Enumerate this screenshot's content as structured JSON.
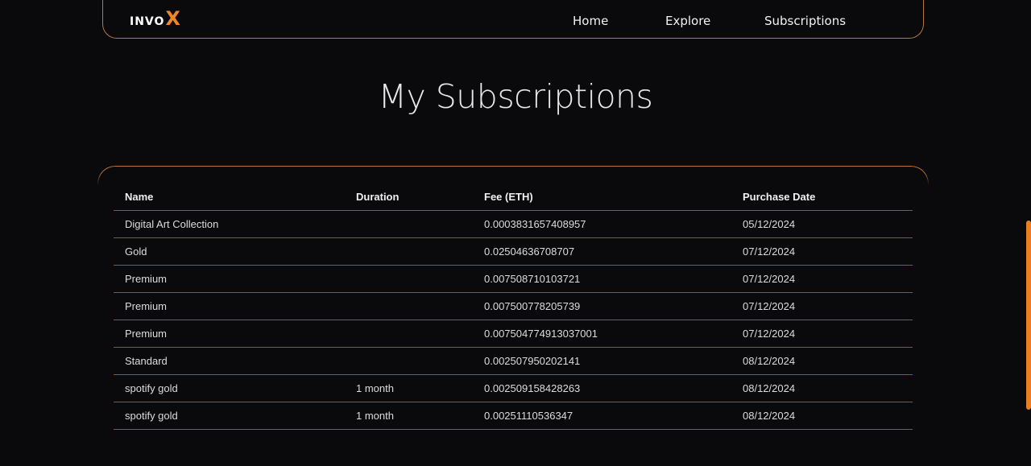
{
  "nav": {
    "logo_text": "INVO",
    "logo_accent": "X",
    "links": [
      "Home",
      "Explore",
      "Subscriptions"
    ]
  },
  "page": {
    "title": "My Subscriptions"
  },
  "table": {
    "headers": [
      "Name",
      "Duration",
      "Fee (ETH)",
      "Purchase Date"
    ],
    "rows": [
      {
        "name": "Digital Art Collection",
        "duration": "",
        "fee": "0.0003831657408957",
        "date": "05/12/2024"
      },
      {
        "name": "Gold",
        "duration": "",
        "fee": "0.02504636708707",
        "date": "07/12/2024"
      },
      {
        "name": "Premium",
        "duration": "",
        "fee": "0.007508710103721",
        "date": "07/12/2024"
      },
      {
        "name": "Premium",
        "duration": "",
        "fee": "0.007500778205739",
        "date": "07/12/2024"
      },
      {
        "name": "Premium",
        "duration": "",
        "fee": "0.007504774913037001",
        "date": "07/12/2024"
      },
      {
        "name": "Standard",
        "duration": "",
        "fee": "0.002507950202141",
        "date": "08/12/2024"
      },
      {
        "name": "spotify gold",
        "duration": "1 month",
        "fee": "0.002509158428263",
        "date": "08/12/2024"
      },
      {
        "name": "spotify gold",
        "duration": "1 month",
        "fee": "0.00251110536347",
        "date": "08/12/2024"
      }
    ]
  },
  "colors": {
    "accent": "#f0862a",
    "border": "#b8783a",
    "background": "#0a0a0c"
  }
}
